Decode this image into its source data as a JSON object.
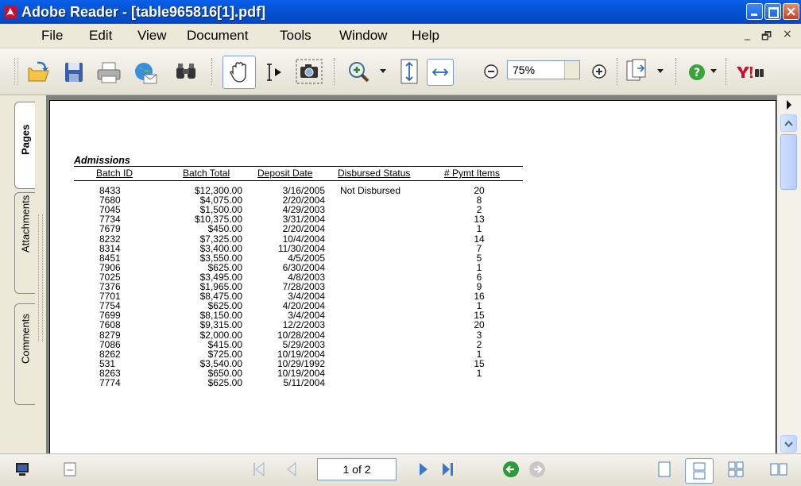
{
  "window": {
    "title": "Adobe Reader - [table965816[1].pdf]"
  },
  "menu": {
    "items": [
      "File",
      "Edit",
      "View",
      "Document",
      "Tools",
      "Window",
      "Help"
    ],
    "mdi_controls": [
      "_",
      "🗗",
      "×"
    ]
  },
  "toolbar": {
    "zoom_value": "75%",
    "icons": [
      "open-icon",
      "save-icon",
      "print-icon",
      "email-icon",
      "search-icon",
      "hand-tool-icon",
      "select-text-icon",
      "snapshot-icon",
      "zoom-in-icon",
      "fit-page-icon",
      "fit-width-icon",
      "zoom-out-minus-icon",
      "zoom-plus-icon",
      "pages-menu-icon",
      "help-icon",
      "yahoo-search-icon"
    ]
  },
  "nav_tabs": [
    "Pages",
    "Attachments",
    "Comments"
  ],
  "document": {
    "section_title": "Admissions",
    "columns": [
      "Batch ID",
      "Batch Total",
      "Deposit Date",
      "Disbursed Status",
      "# Pymt Items"
    ],
    "rows": [
      {
        "id": "8433",
        "total": "$12,300.00",
        "date": "3/16/2005",
        "status": "Not Disbursed",
        "items": "20"
      },
      {
        "id": "7680",
        "total": "$4,075.00",
        "date": "2/20/2004",
        "status": "",
        "items": "8"
      },
      {
        "id": "7045",
        "total": "$1,500.00",
        "date": "4/29/2003",
        "status": "",
        "items": "2"
      },
      {
        "id": "7734",
        "total": "$10,375.00",
        "date": "3/31/2004",
        "status": "",
        "items": "13"
      },
      {
        "id": "7679",
        "total": "$450.00",
        "date": "2/20/2004",
        "status": "",
        "items": "1"
      },
      {
        "id": "8232",
        "total": "$7,325.00",
        "date": "10/4/2004",
        "status": "",
        "items": "14"
      },
      {
        "id": "8314",
        "total": "$3,400.00",
        "date": "11/30/2004",
        "status": "",
        "items": "7"
      },
      {
        "id": "8451",
        "total": "$3,550.00",
        "date": "4/5/2005",
        "status": "",
        "items": "5"
      },
      {
        "id": "7906",
        "total": "$625.00",
        "date": "6/30/2004",
        "status": "",
        "items": "1"
      },
      {
        "id": "7025",
        "total": "$3,495.00",
        "date": "4/8/2003",
        "status": "",
        "items": "6"
      },
      {
        "id": "7376",
        "total": "$1,965.00",
        "date": "7/28/2003",
        "status": "",
        "items": "9"
      },
      {
        "id": "7701",
        "total": "$8,475.00",
        "date": "3/4/2004",
        "status": "",
        "items": "16"
      },
      {
        "id": "7754",
        "total": "$625.00",
        "date": "4/20/2004",
        "status": "",
        "items": "1"
      },
      {
        "id": "7699",
        "total": "$8,150.00",
        "date": "3/4/2004",
        "status": "",
        "items": "15"
      },
      {
        "id": "7608",
        "total": "$9,315.00",
        "date": "12/2/2003",
        "status": "",
        "items": "20"
      },
      {
        "id": "8279",
        "total": "$2,000.00",
        "date": "10/28/2004",
        "status": "",
        "items": "3"
      },
      {
        "id": "7086",
        "total": "$415.00",
        "date": "5/29/2003",
        "status": "",
        "items": "2"
      },
      {
        "id": "8262",
        "total": "$725.00",
        "date": "10/19/2004",
        "status": "",
        "items": "1"
      },
      {
        "id": "531",
        "total": "$3,540.00",
        "date": "10/29/1992",
        "status": "",
        "items": "15"
      },
      {
        "id": "8263",
        "total": "$650.00",
        "date": "10/19/2004",
        "status": "",
        "items": "1"
      },
      {
        "id": "7774",
        "total": "$625.00",
        "date": "5/11/2004",
        "status": "",
        "items": ""
      }
    ]
  },
  "status": {
    "page_count": "1 of 2"
  }
}
